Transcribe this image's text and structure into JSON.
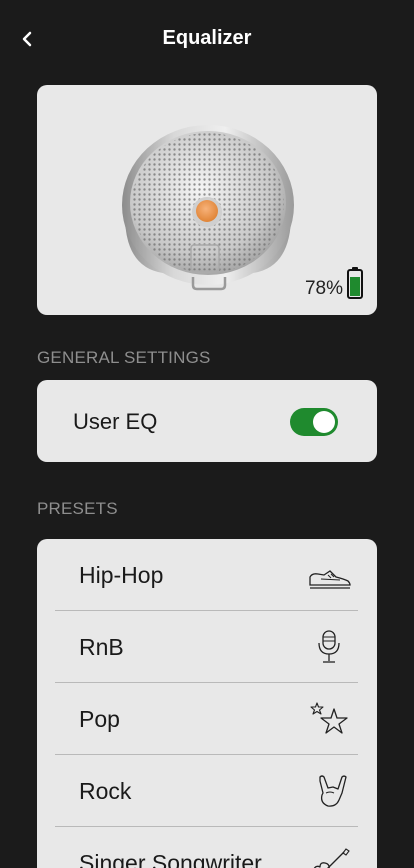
{
  "header": {
    "title": "Equalizer",
    "back_icon": "chevron-left-icon"
  },
  "device": {
    "battery_percent_label": "78%",
    "battery_level": 0.78,
    "battery_color": "#1f8a2e"
  },
  "general": {
    "section_title": "GENERAL SETTINGS",
    "user_eq_label": "User EQ",
    "user_eq_enabled": true,
    "toggle_color": "#1f8a2e"
  },
  "presets": {
    "section_title": "PRESETS",
    "items": [
      {
        "label": "Hip-Hop",
        "icon": "sneaker-icon"
      },
      {
        "label": "RnB",
        "icon": "microphone-icon"
      },
      {
        "label": "Pop",
        "icon": "stars-icon"
      },
      {
        "label": "Rock",
        "icon": "rock-hand-icon"
      },
      {
        "label": "Singer Songwriter",
        "icon": "guitar-icon"
      }
    ]
  }
}
